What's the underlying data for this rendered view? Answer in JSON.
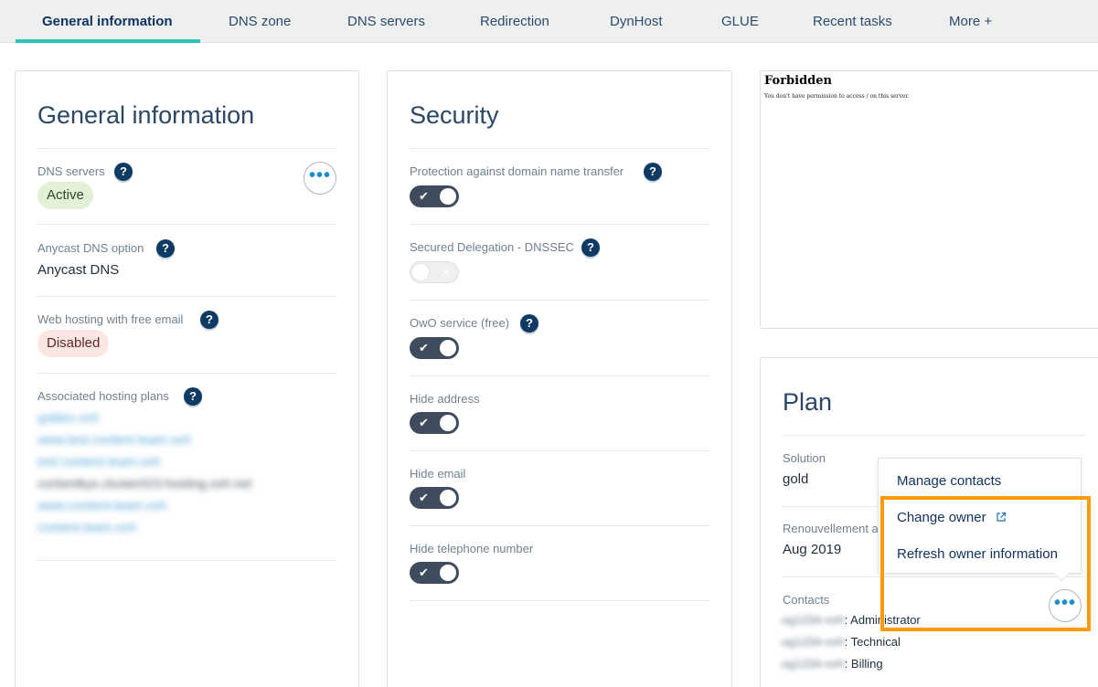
{
  "tabs": [
    {
      "label": "General information",
      "active": true
    },
    {
      "label": "DNS zone"
    },
    {
      "label": "DNS servers"
    },
    {
      "label": "Redirection"
    },
    {
      "label": "DynHost"
    },
    {
      "label": "GLUE"
    },
    {
      "label": "Recent tasks"
    },
    {
      "label": "More +"
    }
  ],
  "general": {
    "title": "General information",
    "dns_servers": {
      "label": "DNS servers",
      "status": "Active"
    },
    "anycast": {
      "label": "Anycast DNS option",
      "value": "Anycast DNS"
    },
    "web_hosting": {
      "label": "Web hosting with free email",
      "status": "Disabled"
    },
    "hosting_plans": {
      "label": "Associated hosting plans",
      "items": [
        "goldes.ovh",
        "www.test.content-team.ovh",
        "test.content-team.ovh",
        "contentkys.cluster023.hosting.ovh.net",
        "www.content-team.ovh",
        "content-team.ovh"
      ]
    }
  },
  "security": {
    "title": "Security",
    "options": [
      {
        "label": "Protection against domain name transfer",
        "enabled": true,
        "help": true
      },
      {
        "label": "Secured Delegation - DNSSEC",
        "enabled": false,
        "help": true
      },
      {
        "label": "OwO service (free)",
        "enabled": true,
        "help": true
      },
      {
        "label": "Hide address",
        "enabled": true,
        "help": false
      },
      {
        "label": "Hide email",
        "enabled": true,
        "help": false
      },
      {
        "label": "Hide telephone number",
        "enabled": true,
        "help": false
      }
    ]
  },
  "forbidden": {
    "title": "Forbidden",
    "message": "You don't have permission to access / on this server."
  },
  "plan": {
    "title": "Plan",
    "solution_label": "Solution",
    "solution_value": "gold",
    "renewal_label": "Renouvellement a",
    "renewal_value": "Aug 2019",
    "contacts_label": "Contacts",
    "contacts": [
      {
        "name": "og1234-ovh",
        "role": ": Administrator"
      },
      {
        "name": "og1234-ovh",
        "role": ": Technical"
      },
      {
        "name": "og1234-ovh",
        "role": ": Billing"
      }
    ]
  },
  "menu": {
    "items": [
      "Manage contacts",
      "Change owner",
      "Refresh owner information"
    ]
  },
  "icons": {
    "help": "question-mark-icon",
    "more": "ellipsis-icon",
    "external": "external-link-icon",
    "check": "check-icon",
    "cross": "cross-icon"
  },
  "colors": {
    "accent": "#2bc4b6",
    "highlight": "#ff9b0b",
    "toggle_on": "#3e4c5d",
    "help_bg": "#0f3a63"
  }
}
